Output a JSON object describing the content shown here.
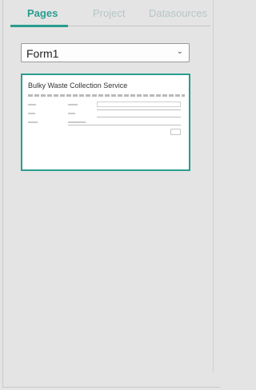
{
  "tabs": [
    {
      "label": "Pages",
      "active": true
    },
    {
      "label": "Project",
      "active": false
    },
    {
      "label": "Datasources",
      "active": false
    }
  ],
  "colors": {
    "accent": "#2a9d8f",
    "inactive_tab": "#b7c5c5",
    "background": "#e4e4e4"
  },
  "page_select": {
    "value": "Form1",
    "icon": "chevron-down-icon"
  },
  "page_thumbnail": {
    "title": "Bulky Waste Collection Service"
  }
}
